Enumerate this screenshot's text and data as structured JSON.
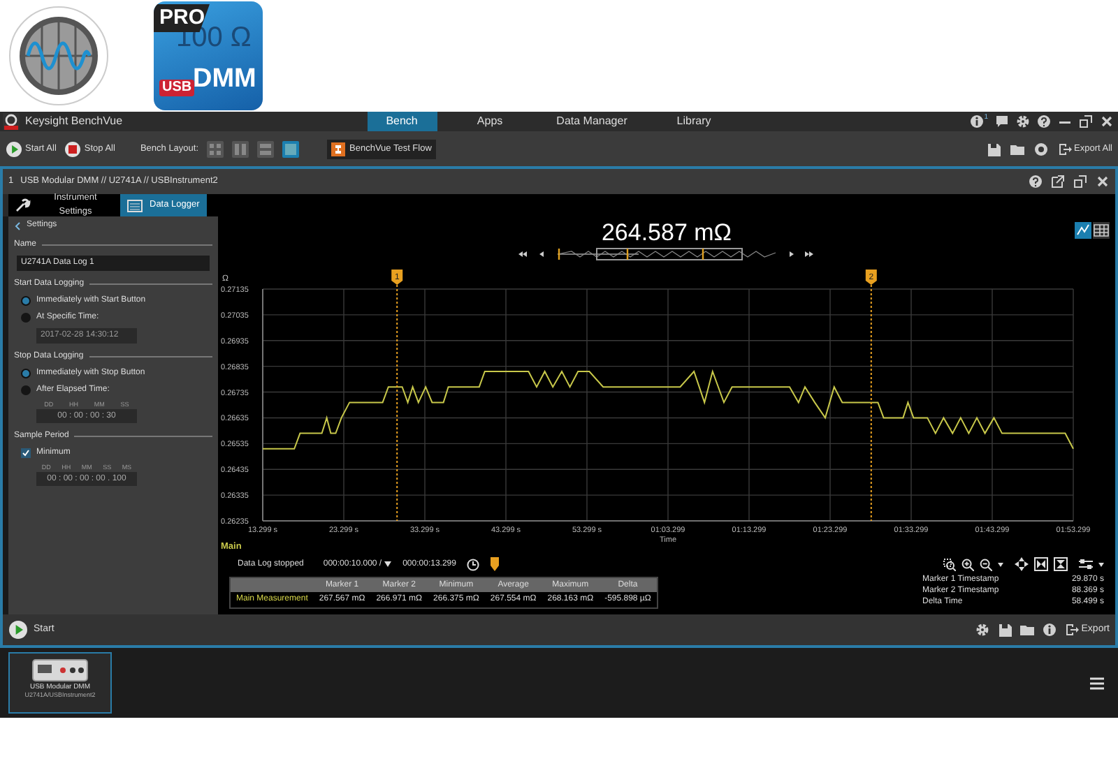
{
  "dmm_icon": {
    "badge": "PRO",
    "reading": "100 Ω",
    "tag": "USB",
    "label": "DMM"
  },
  "window": {
    "title": "Keysight BenchVue",
    "notifications": "1"
  },
  "nav_tabs": [
    {
      "label": "Bench",
      "selected": true
    },
    {
      "label": "Apps",
      "selected": false
    },
    {
      "label": "Data Manager",
      "selected": false
    },
    {
      "label": "Library",
      "selected": false
    }
  ],
  "toolbar": {
    "start_all": "Start All",
    "stop_all": "Stop All",
    "layout_label": "Bench Layout:",
    "layouts": [
      {
        "kind": "quad",
        "selected": false
      },
      {
        "kind": "columns",
        "selected": false
      },
      {
        "kind": "rows",
        "selected": false
      },
      {
        "kind": "single",
        "selected": true
      }
    ],
    "test_flow": "BenchVue Test Flow",
    "export": "Export All"
  },
  "instrument": {
    "index": "1",
    "title": "USB Modular DMM // U2741A // USBInstrument2",
    "tabs": [
      {
        "kind": "settings",
        "label": "Instrument Settings",
        "selected": false
      },
      {
        "kind": "logger",
        "label": "Data Logger",
        "selected": true
      }
    ]
  },
  "settings": {
    "title": "Settings",
    "name_label": "Name",
    "name_value": "U2741A Data Log 1",
    "start": {
      "label": "Start Data Logging",
      "options": [
        {
          "label": "Immediately with Start Button",
          "selected": true
        },
        {
          "label": "At Specific Time:",
          "selected": false
        }
      ],
      "time": "2017-02-28 14:30:12"
    },
    "stop": {
      "label": "Stop Data Logging",
      "options": [
        {
          "label": "Immediately with Stop Button",
          "selected": true
        },
        {
          "label": "After Elapsed Time:",
          "selected": false
        }
      ],
      "units": [
        "DD",
        "HH",
        "MM",
        "SS"
      ],
      "time": "00 : 00 : 00 : 30"
    },
    "sample": {
      "label": "Sample Period",
      "checkbox": {
        "label": "Minimum",
        "checked": true
      },
      "units": [
        "DD",
        "HH",
        "MM",
        "SS",
        "MS"
      ],
      "time": "00 : 00 : 00 : 00 . 100"
    }
  },
  "logger": {
    "reading": "264.587 mΩ",
    "views": [
      {
        "kind": "chart",
        "selected": true
      },
      {
        "kind": "table",
        "selected": false
      }
    ],
    "chart_data": {
      "type": "line",
      "xlabel": "Time",
      "ylabel": "Ω",
      "xlim": [
        13.299,
        113.299
      ],
      "ylim": [
        0.26235,
        0.27135
      ],
      "x": [
        13.3,
        17.2,
        17.9,
        20.6,
        21.2,
        21.7,
        22.3,
        23.0,
        24.0,
        28.1,
        28.8,
        30.5,
        31.2,
        31.8,
        32.5,
        33.4,
        34.2,
        35.6,
        36.2,
        40.0,
        40.7,
        46.1,
        47.1,
        48.1,
        49.1,
        50.2,
        51.2,
        52.2,
        53.6,
        55.3,
        64.8,
        66.5,
        67.8,
        68.8,
        70.2,
        71.2,
        78.3,
        79.4,
        80.2,
        81.4,
        82.7,
        83.8,
        84.8,
        89.2,
        89.9,
        92.3,
        92.9,
        93.6,
        95.3,
        96.3,
        97.3,
        98.4,
        99.4,
        100.4,
        101.4,
        102.4,
        103.5,
        104.5,
        105.5,
        112.3,
        113.299
      ],
      "series": [
        {
          "name": "Main",
          "color": "#c8c84a",
          "values": [
            0.26515,
            0.26515,
            0.26575,
            0.26575,
            0.26635,
            0.26575,
            0.26575,
            0.26635,
            0.26695,
            0.26695,
            0.26755,
            0.26755,
            0.26695,
            0.26755,
            0.26695,
            0.26755,
            0.26695,
            0.26695,
            0.26755,
            0.26755,
            0.26815,
            0.26815,
            0.26755,
            0.26815,
            0.26755,
            0.26815,
            0.26755,
            0.26815,
            0.26815,
            0.26755,
            0.26755,
            0.26815,
            0.26695,
            0.26815,
            0.26695,
            0.26755,
            0.26755,
            0.26695,
            0.26755,
            0.26695,
            0.26635,
            0.26755,
            0.26695,
            0.26695,
            0.26635,
            0.26635,
            0.26695,
            0.26635,
            0.26635,
            0.26575,
            0.26635,
            0.26575,
            0.26635,
            0.26575,
            0.26635,
            0.26575,
            0.26635,
            0.26575,
            0.26575,
            0.26575,
            0.26515
          ]
        }
      ],
      "xticks": [
        {
          "value": 13.299,
          "label": "13.299 s"
        },
        {
          "value": 23.299,
          "label": "23.299 s"
        },
        {
          "value": 33.299,
          "label": "33.299 s"
        },
        {
          "value": 43.299,
          "label": "43.299 s"
        },
        {
          "value": 53.299,
          "label": "53.299 s"
        },
        {
          "value": 63.299,
          "label": "01:03.299"
        },
        {
          "value": 73.299,
          "label": "01:13.299"
        },
        {
          "value": 83.299,
          "label": "01:23.299"
        },
        {
          "value": 93.299,
          "label": "01:33.299"
        },
        {
          "value": 103.299,
          "label": "01:43.299"
        },
        {
          "value": 113.299,
          "label": "01:53.299"
        }
      ],
      "yticks": [
        0.26235,
        0.26335,
        0.26435,
        0.26535,
        0.26635,
        0.26735,
        0.26835,
        0.26935,
        0.27035,
        0.27135
      ],
      "grid": true,
      "ref_lines": [
        {
          "axis": "x",
          "value": 29.87,
          "color": "#e8a020"
        },
        {
          "axis": "x",
          "value": 88.369,
          "color": "#e8a020"
        }
      ]
    },
    "marker_flags": [
      "1",
      "2"
    ],
    "status": "Data Log stopped",
    "interval": "000:00:10.000 /",
    "elapsed": "000:00:13.299",
    "stats_table": {
      "columns": [
        "Marker 1",
        "Marker 2",
        "Minimum",
        "Average",
        "Maximum",
        "Delta"
      ],
      "rows": [
        {
          "label": "Main Measurement",
          "cells": [
            "267.567 mΩ",
            "266.971 mΩ",
            "266.375 mΩ",
            "267.554 mΩ",
            "268.163 mΩ",
            "-595.898 µΩ"
          ]
        }
      ]
    },
    "marker_info": [
      {
        "label": "Marker 1 Timestamp",
        "value": "29.870 s"
      },
      {
        "label": "Marker 2 Timestamp",
        "value": "88.369 s"
      },
      {
        "label": "Delta Time",
        "value": "58.499 s"
      }
    ]
  },
  "bottom_bar": {
    "start": "Start",
    "export": "Export"
  },
  "dock": {
    "title": "USB Modular DMM",
    "subtitle": "U2741A/USBInstrument2"
  }
}
